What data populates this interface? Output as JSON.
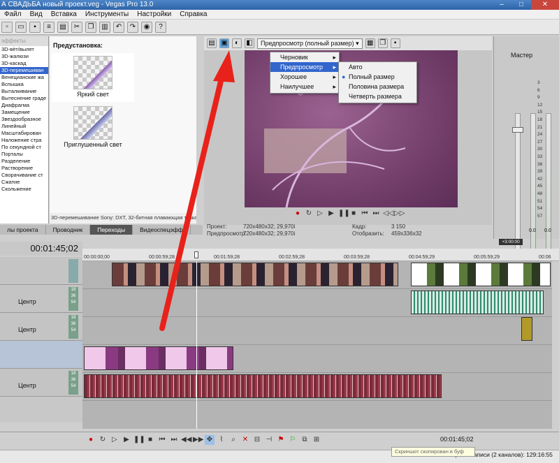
{
  "window": {
    "title": "А СВАДЬБА новый проект.veg - Vegas Pro 13.0"
  },
  "menubar": [
    "Файл",
    "Вид",
    "Вставка",
    "Инструменты",
    "Настройки",
    "Справка"
  ],
  "left_panel": {
    "header": "эффекты",
    "items": [
      "3D-вѐт/вылет",
      "3D-жалюзи",
      "3D-каскад",
      "3D-перемешиван",
      "Венецианские жа",
      "Вспышка",
      "Выталкивание",
      "Вытеснение граде",
      "Диафрагма",
      "Замещение",
      "Звездообразное",
      "Линейный",
      "Масштабирован",
      "Наложение стра",
      "По секундной ст",
      "Порталы",
      "Разделение",
      "Растворение",
      "Сворачивание ст",
      "Сжатие",
      "Скольжение"
    ],
    "selected_index": 3
  },
  "presets": {
    "title": "Предустановка:",
    "items": [
      "Яркий свет",
      "Приглушенный свет"
    ],
    "status": "3D-перемешивание Sony: DXT, 32-битная плавающая точка"
  },
  "tabs": [
    "лы проекта",
    "Проводник",
    "Переходы",
    "Видеоспецэфф"
  ],
  "active_tab": 2,
  "preview": {
    "combo": "Предпросмотр (полный размер)",
    "menu1": [
      {
        "label": "Черновик",
        "highlight": false
      },
      {
        "label": "Предпросмотр",
        "highlight": true
      },
      {
        "label": "Хорошее",
        "highlight": false
      },
      {
        "label": "Наилучшее",
        "highlight": false
      }
    ],
    "menu2": [
      {
        "label": "Авто",
        "selected": false
      },
      {
        "label": "Полный размер",
        "selected": true
      },
      {
        "label": "Половина размера",
        "selected": false
      },
      {
        "label": "Четверть размера",
        "selected": false
      }
    ],
    "info": {
      "project_label": "Проект:",
      "project_value": "720x480x32; 29,970i",
      "preview_label": "Предпросмотр:",
      "preview_value": "720x480x32; 29,970i",
      "frame_label": "Кадр:",
      "frame_value": "3 150",
      "display_label": "Отобразить:",
      "display_value": "459x336x32"
    }
  },
  "mixer": {
    "title": "Мастер",
    "scale": [
      "3",
      "6",
      "9",
      "12",
      "15",
      "18",
      "21",
      "24",
      "27",
      "30",
      "33",
      "36",
      "39",
      "42",
      "45",
      "48",
      "51",
      "54",
      "57"
    ],
    "readouts": [
      "0.0",
      "0.0"
    ]
  },
  "timeline": {
    "timecode": "00:01:45;02",
    "ruler": [
      "00:00:00;00",
      "00:00:59;28",
      "00:01:59;28",
      "00:02:59;28",
      "00:03:59;28",
      "00:04:59;29",
      "00:05:59;29",
      "00:06"
    ],
    "marker": "+3:00:00",
    "track_center": "Центр",
    "vol_text": [
      "18",
      "36",
      "54"
    ]
  },
  "bottom": {
    "timecode": "00:01:45;02",
    "record_time": "Время записи (2 каналов): 129:16:55",
    "tooltip": "Скриншот скопирован в буф"
  }
}
